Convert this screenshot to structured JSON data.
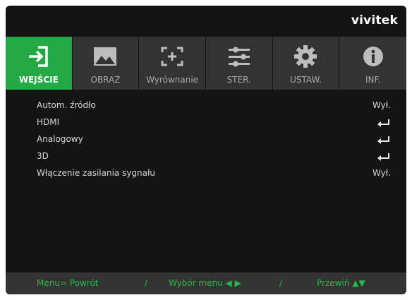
{
  "brand": "vivitek",
  "tabs": [
    {
      "label": "WEJŚCIE",
      "icon": "input-arrow-icon",
      "active": true
    },
    {
      "label": "OBRAZ",
      "icon": "image-icon",
      "active": false
    },
    {
      "label": "Wyrównanie",
      "icon": "alignment-icon",
      "active": false
    },
    {
      "label": "STER.",
      "icon": "sliders-icon",
      "active": false
    },
    {
      "label": "USTAW.",
      "icon": "gear-icon",
      "active": false
    },
    {
      "label": "INF.",
      "icon": "info-icon",
      "active": false
    }
  ],
  "menu": {
    "items": [
      {
        "label": "Autom. źródło",
        "value": "Wył.",
        "type": "value"
      },
      {
        "label": "HDMI",
        "value": "",
        "type": "enter",
        "icon": "enter-arrow-icon"
      },
      {
        "label": "Analogowy",
        "value": "",
        "type": "enter",
        "icon": "enter-arrow-icon"
      },
      {
        "label": "3D",
        "value": "",
        "type": "enter",
        "icon": "enter-arrow-icon"
      },
      {
        "label": "Włączenie zasilania sygnału",
        "value": "Wył.",
        "type": "value"
      }
    ]
  },
  "footer": {
    "back": "Menu= Powrót",
    "sep1": "/",
    "select": "Wybór menu ◀ ▶",
    "sep2": "/",
    "scroll": "Przewiń ▲▼"
  },
  "colors": {
    "accent": "#22a844",
    "footer_text": "#29b84a",
    "background": "#141414",
    "tabbar": "#333333"
  }
}
